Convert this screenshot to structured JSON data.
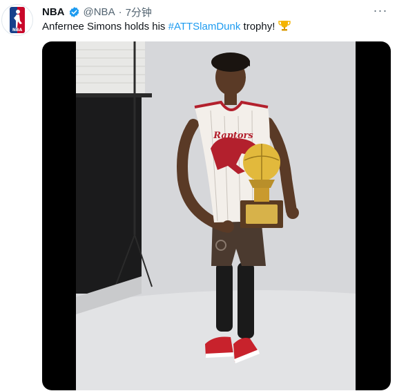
{
  "tweet": {
    "author": "NBA",
    "handle": "@NBA",
    "separator": "·",
    "time": "7分钟",
    "text_before": "Anfernee Simons holds his ",
    "hashtag": "#ATTSlamDunk",
    "text_after": " trophy!",
    "emoji": "trophy-icon",
    "more_label": "···"
  },
  "colors": {
    "link": "#1d9bf0",
    "verified": "#1d9bf0",
    "muted": "#536471",
    "nba_blue": "#17408b",
    "nba_red": "#c9082a"
  },
  "media": {
    "type": "video",
    "subject": "basketball player holding trophy"
  }
}
